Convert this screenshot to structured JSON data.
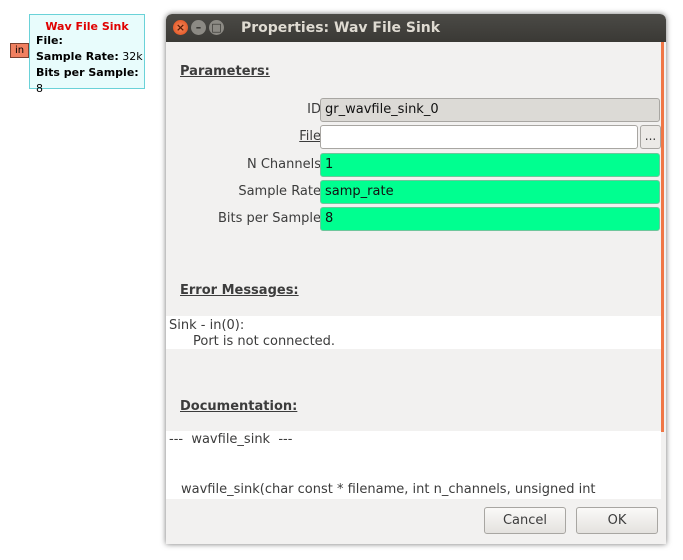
{
  "block": {
    "title": "Wav File Sink",
    "port_in": "in",
    "lines": [
      {
        "key": "File:",
        "value": ""
      },
      {
        "key": "Sample Rate:",
        "value": " 32k"
      },
      {
        "key": "Bits per Sample:",
        "value": " 8"
      }
    ]
  },
  "dialog": {
    "title": "Properties: Wav File Sink",
    "parameters_heading": "Parameters:",
    "params": [
      {
        "label": "ID",
        "value": "gr_wavfile_sink_0"
      },
      {
        "label": "File",
        "value": ""
      },
      {
        "label": "N Channels",
        "value": "1"
      },
      {
        "label": "Sample Rate",
        "value": "samp_rate"
      },
      {
        "label": "Bits per Sample",
        "value": "8"
      }
    ],
    "browse_label": "...",
    "errors_heading": "Error Messages:",
    "error_line1": "Sink - in(0):",
    "error_line2": "Port is not connected.",
    "docs_heading": "Documentation:",
    "doc_line1": "---  wavfile_sink  ---",
    "doc_line2": "wavfile_sink(char const * filename, int n_channels, unsigned int",
    "cancel_label": "Cancel",
    "ok_label": "OK"
  },
  "colors": {
    "valid_field": "#00ff90",
    "block_title": "#e00000",
    "port": "#f08060",
    "accent": "#f07746"
  }
}
